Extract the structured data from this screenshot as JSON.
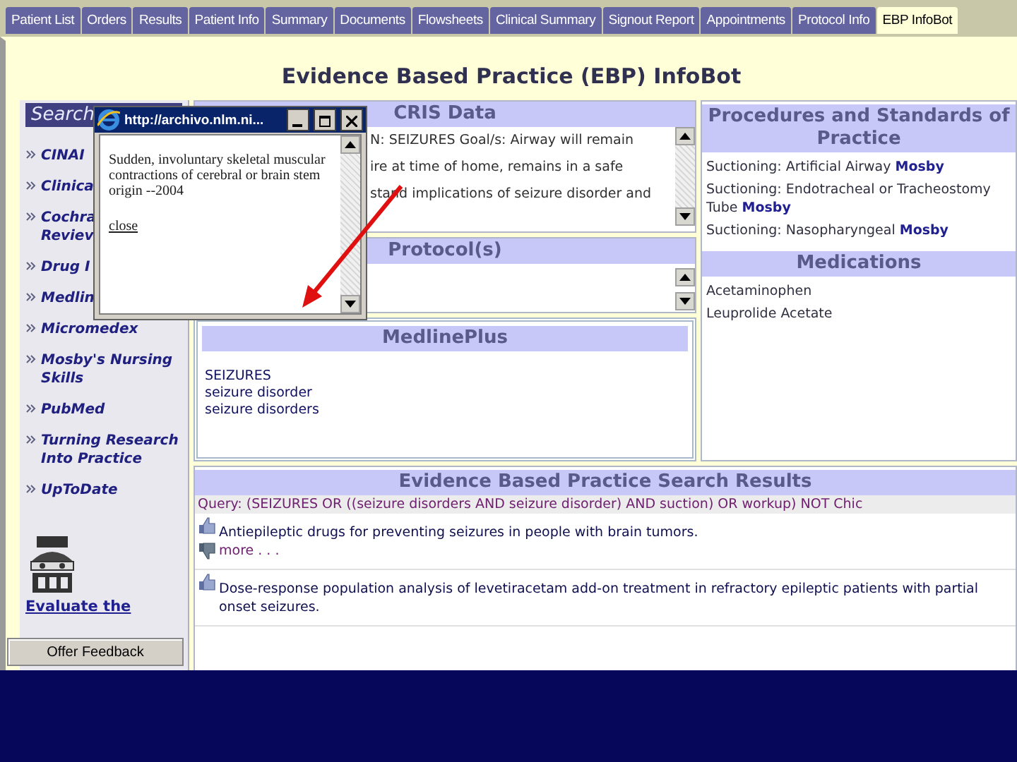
{
  "tabs": [
    {
      "label": "Patient List",
      "selected": false
    },
    {
      "label": "Orders",
      "selected": false
    },
    {
      "label": "Results",
      "selected": false
    },
    {
      "label": "Patient Info",
      "selected": false
    },
    {
      "label": "Summary",
      "selected": false
    },
    {
      "label": "Documents",
      "selected": false
    },
    {
      "label": "Flowsheets",
      "selected": false
    },
    {
      "label": "Clinical Summary",
      "selected": false
    },
    {
      "label": "Signout Report",
      "selected": false
    },
    {
      "label": "Appointments",
      "selected": false
    },
    {
      "label": "Protocol Info",
      "selected": false
    },
    {
      "label": "EBP InfoBot",
      "selected": true
    }
  ],
  "title": "Evidence Based Practice (EBP) InfoBot",
  "sidebar": {
    "header": "Search",
    "links": [
      {
        "label": "CINAI"
      },
      {
        "label": "Clinica"
      },
      {
        "label": "Cochra\nReviev"
      },
      {
        "label": "Drug I"
      },
      {
        "label": "Medlin"
      },
      {
        "label": "Micromedex"
      },
      {
        "label": "Mosby's Nursing\nSkills"
      },
      {
        "label": "PubMed"
      },
      {
        "label": "Turning Research\nInto Practice"
      },
      {
        "label": "UpToDate"
      }
    ],
    "evaluate_link": "Evaluate the"
  },
  "cris": {
    "title": "CRIS Data",
    "lines": [
      "N: SEIZURES Goal/s: Airway will remain",
      "ire at time of home, remains in a safe",
      "stand implications of seizure disorder and"
    ]
  },
  "protocols": {
    "title": "Protocol(s)"
  },
  "medlineplus": {
    "title": "MedlinePlus",
    "items": [
      "SEIZURES",
      "seizure disorder",
      "seizure disorders"
    ]
  },
  "procedures": {
    "title": "Procedures and Standards of Practice",
    "items": [
      {
        "text": "Suctioning: Artificial Airway",
        "source": "Mosby"
      },
      {
        "text": "Suctioning: Endotracheal or Tracheostomy Tube",
        "source": "Mosby"
      },
      {
        "text": "Suctioning: Nasopharyngeal",
        "source": "Mosby"
      }
    ]
  },
  "medications": {
    "title": "Medications",
    "items": [
      "Acetaminophen",
      "Leuprolide Acetate"
    ]
  },
  "results": {
    "title": "Evidence Based Practice Search Results",
    "query": "Query: (SEIZURES OR ((seizure disorders AND seizure disorder) AND suction) OR workup) NOT Chic",
    "items": [
      {
        "title": "Antiepileptic drugs for preventing seizures in people with brain tumors.",
        "more": "more . . ."
      },
      {
        "title": "Dose-response population analysis of levetiracetam add-on treatment in refractory epileptic patients with partial onset seizures."
      }
    ]
  },
  "feedback_button": "Offer Feedback",
  "popup": {
    "url": "http://archivo.nlm.ni...",
    "text": "Sudden, involuntary skeletal muscular contractions of cerebral or brain stem origin --2004",
    "close_link": "close"
  }
}
